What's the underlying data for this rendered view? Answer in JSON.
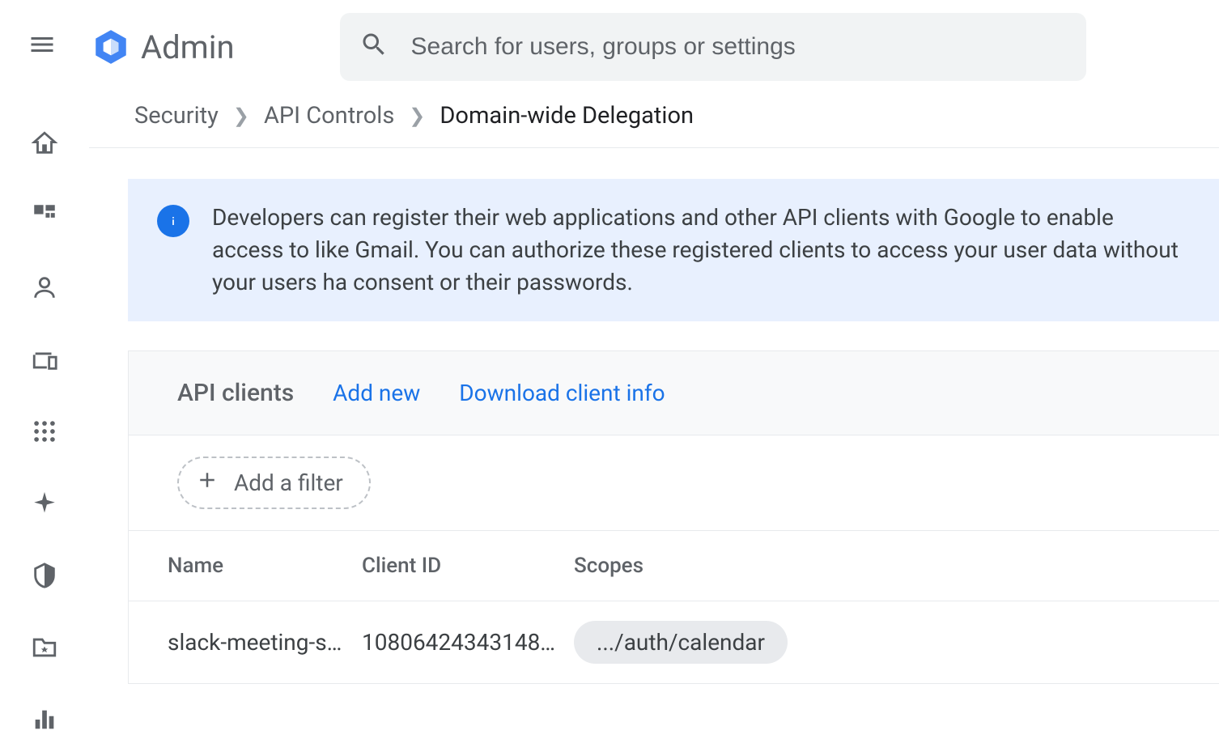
{
  "header": {
    "title": "Admin",
    "search_placeholder": "Search for users, groups or settings"
  },
  "breadcrumb": {
    "items": [
      "Security",
      "API Controls"
    ],
    "current": "Domain-wide Delegation"
  },
  "banner": {
    "text": "Developers can register their web applications and other API clients with Google to enable access to like Gmail. You can authorize these registered clients to access your user data without your users ha consent or their passwords."
  },
  "card": {
    "title": "API clients",
    "add_new_label": "Add new",
    "download_label": "Download client info",
    "filter_label": "Add a filter",
    "columns": {
      "name": "Name",
      "client_id": "Client ID",
      "scopes": "Scopes"
    },
    "rows": [
      {
        "name": "slack-meeting-s…",
        "client_id": "10806424343148…",
        "scope": ".../auth/calendar"
      }
    ]
  }
}
